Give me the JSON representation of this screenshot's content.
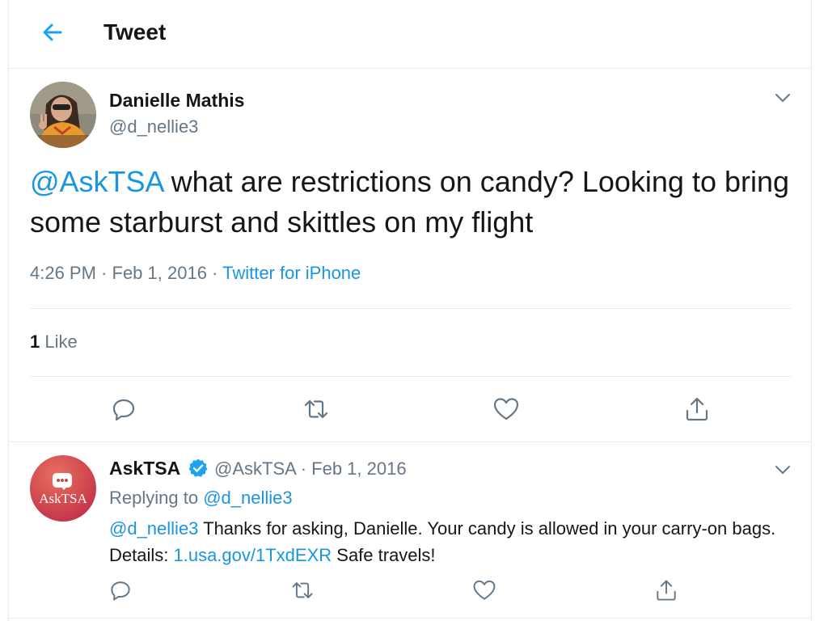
{
  "header": {
    "title": "Tweet"
  },
  "tweet": {
    "author_name": "Danielle Mathis",
    "author_handle": "@d_nellie3",
    "mention": "@AskTSA",
    "text_rest": " what are restrictions on candy? Looking to bring some starburst and skittles on my flight",
    "time": "4:26 PM",
    "sep1": " · ",
    "date": "Feb 1, 2016",
    "sep2": " · ",
    "source": "Twitter for iPhone",
    "like_count": "1",
    "like_label": " Like"
  },
  "reply": {
    "author_name": "AskTSA",
    "avatar_label": "AskTSA",
    "handle": "@AskTSA",
    "dot": " · ",
    "date": "Feb 1, 2016",
    "replying_prefix": "Replying to ",
    "replying_handle": "@d_nellie3",
    "mention": "@d_nellie3",
    "text_part1": " Thanks for asking, Danielle. Your candy is allowed in your carry-on bags. Details: ",
    "link": "1.usa.gov/1TxdEXR",
    "text_part2": " Safe travels!"
  },
  "icons": {
    "back": "arrow-left-icon",
    "chevron": "chevron-down-icon",
    "reply": "reply-icon",
    "retweet": "retweet-icon",
    "like": "heart-icon",
    "share": "share-icon",
    "verified": "verified-badge-icon"
  },
  "colors": {
    "accent": "#1b95e0",
    "muted": "#657786",
    "text": "#14171a",
    "divider": "#e6ecf0"
  }
}
